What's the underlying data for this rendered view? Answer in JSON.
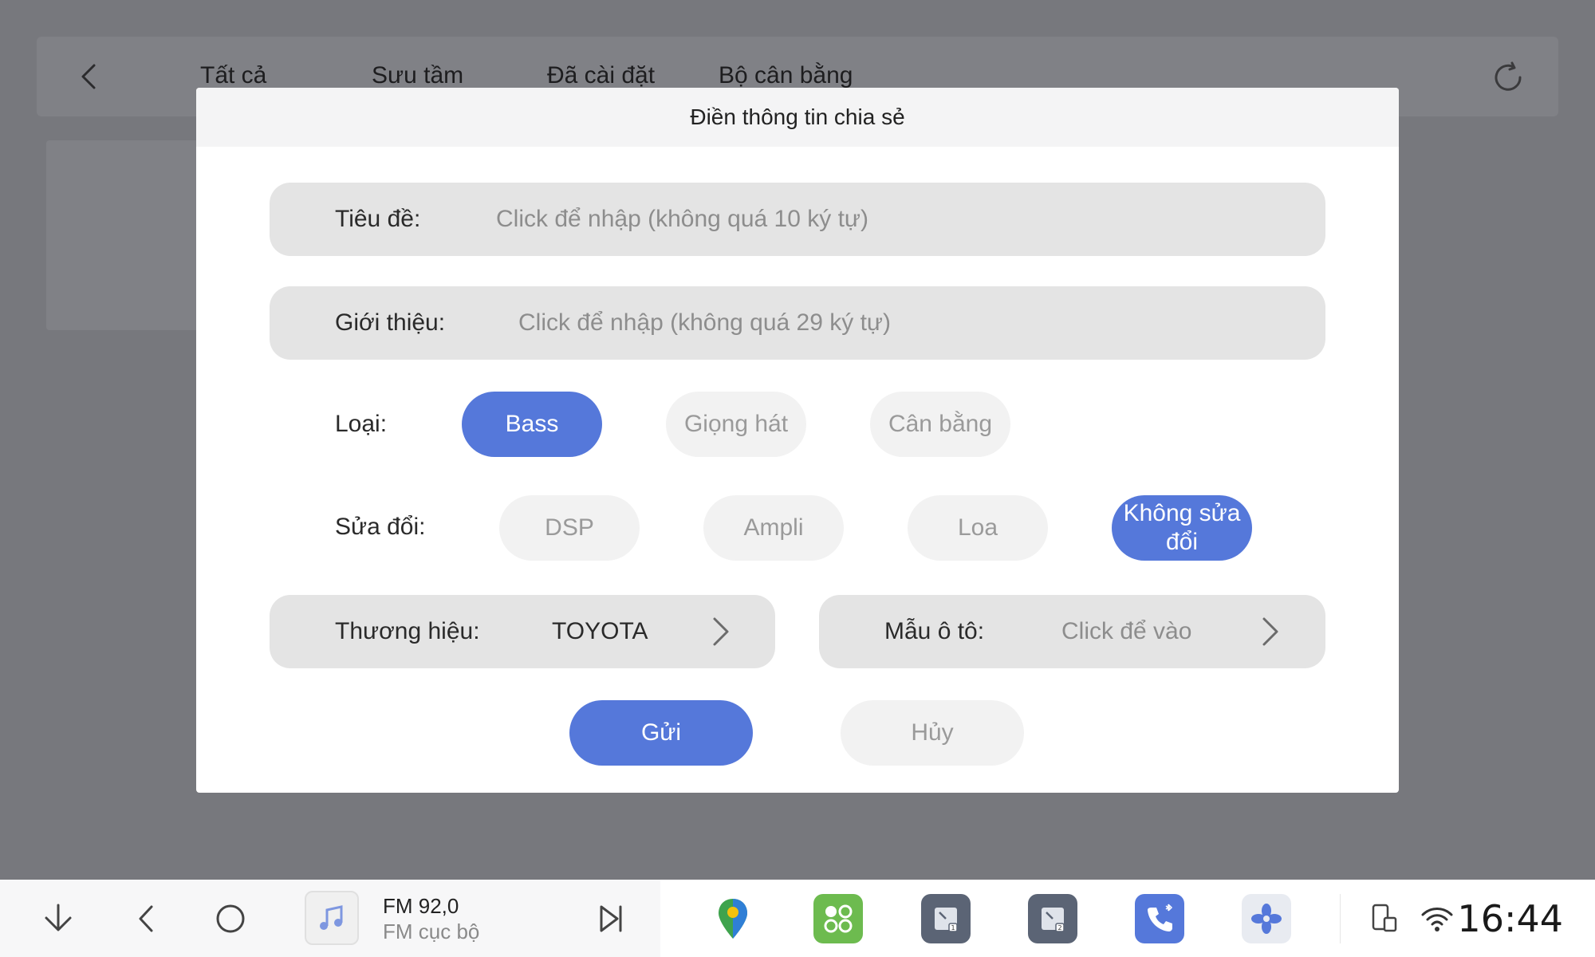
{
  "background": {
    "tabs": [
      "Tất cả",
      "Sưu tầm",
      "Đã cài đặt",
      "Bộ cân bằng"
    ]
  },
  "dialog": {
    "title": "Điền thông tin chia sẻ",
    "title_field": {
      "label": "Tiêu đề:",
      "placeholder": "Click để nhập (không quá 10 ký tự)"
    },
    "intro_field": {
      "label": "Giới thiệu:",
      "placeholder": "Click để nhập (không quá 29 ký tự)"
    },
    "type": {
      "label": "Loại:",
      "options": [
        "Bass",
        "Giọng hát",
        "Cân bằng"
      ],
      "selected": "Bass"
    },
    "modification": {
      "label": "Sửa đổi:",
      "options": [
        "DSP",
        "Ampli",
        "Loa",
        "Không sửa đổi"
      ],
      "selected": "Không sửa đổi"
    },
    "brand": {
      "label": "Thương hiệu:",
      "value": "TOYOTA"
    },
    "car_model": {
      "label": "Mẫu ô tô:",
      "placeholder": "Click để vào"
    },
    "submit_label": "Gửi",
    "cancel_label": "Hủy"
  },
  "taskbar": {
    "media_title": "FM 92,0",
    "media_subtitle": "FM cục bộ",
    "clock": "16:44",
    "colors": {
      "accent": "#5578da",
      "green_app": "#6dbb4f",
      "dark_app": "#5b6475"
    }
  }
}
